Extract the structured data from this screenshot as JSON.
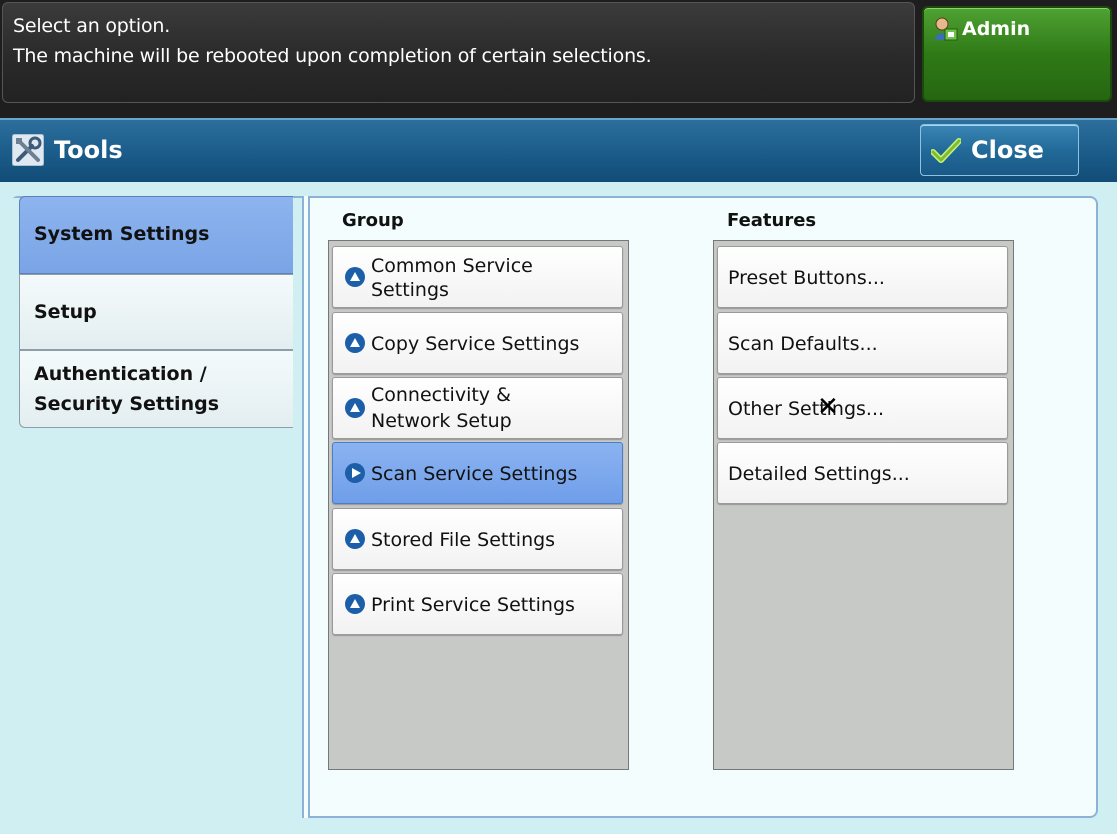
{
  "message": {
    "line1": "Select an option.",
    "line2": "The machine will be rebooted upon completion of certain selections."
  },
  "admin": {
    "label": "Admin",
    "icon": "admin-user-icon"
  },
  "header": {
    "title": "Tools",
    "icon": "tools-icon"
  },
  "close": {
    "label": "Close",
    "icon": "checkmark-icon"
  },
  "tabs": [
    {
      "label": "System Settings",
      "selected": true
    },
    {
      "label": "Setup",
      "selected": false
    },
    {
      "label_line1": "Authentication /",
      "label_line2": "Security Settings",
      "selected": false
    }
  ],
  "group": {
    "heading": "Group",
    "items": [
      {
        "line1": "Common Service",
        "line2": "Settings"
      },
      {
        "line1": "Copy Service Settings"
      },
      {
        "line1": "Connectivity &",
        "line2": "Network Setup"
      },
      {
        "line1": "Scan Service Settings",
        "selected": true
      },
      {
        "line1": "Stored File Settings"
      },
      {
        "line1": "Print Service Settings"
      }
    ]
  },
  "features": {
    "heading": "Features",
    "items": [
      "Preset Buttons...",
      "Scan Defaults...",
      "Other Settings...",
      "Detailed Settings..."
    ]
  },
  "colors": {
    "selected_blue": "#7aa4e6",
    "title_bar": "#1c5d8b",
    "admin_green": "#2f7a17"
  }
}
